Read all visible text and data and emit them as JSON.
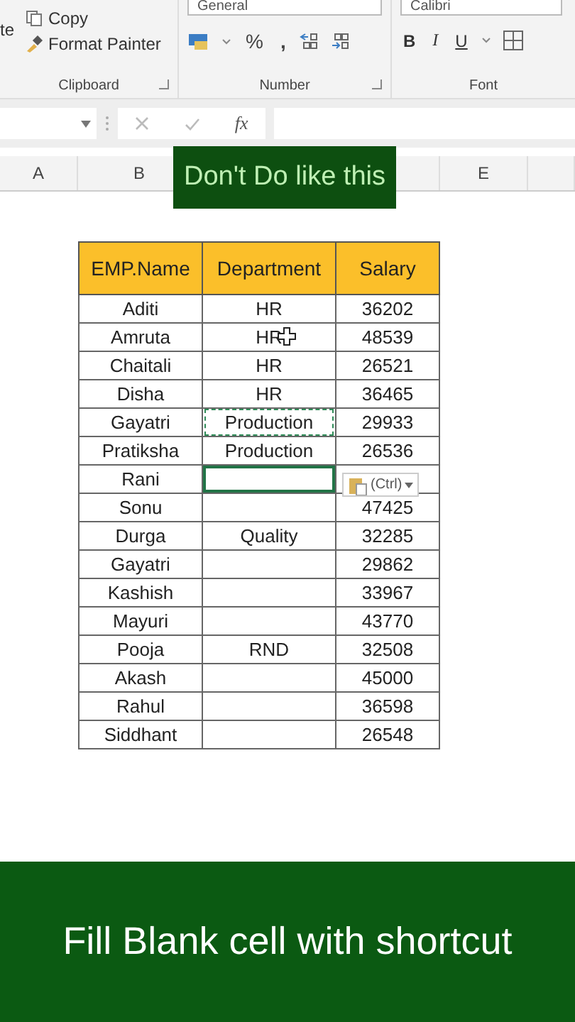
{
  "ribbon": {
    "clipboard": {
      "paste_label": "te",
      "copy": "Copy",
      "format_painter": "Format Painter",
      "group_label": "Clipboard"
    },
    "number": {
      "format": "General",
      "percent": "%",
      "comma": ",",
      "group_label": "Number"
    },
    "font": {
      "font_name": "Calibri",
      "bold": "B",
      "italic": "I",
      "underline": "U",
      "group_label": "Font"
    }
  },
  "formula_bar": {
    "fx": "fx"
  },
  "columns": [
    "A",
    "B",
    "E"
  ],
  "caption": "Don't Do like this",
  "table": {
    "columns": [
      "EMP.Name",
      "Department",
      "Salary"
    ],
    "rows": [
      {
        "name": "Aditi",
        "department": "HR",
        "salary": "36202",
        "copied": false,
        "selected": false
      },
      {
        "name": "Amruta",
        "department": "HR",
        "salary": "48539",
        "copied": false,
        "selected": false
      },
      {
        "name": "Chaitali",
        "department": "HR",
        "salary": "26521",
        "copied": false,
        "selected": false
      },
      {
        "name": "Disha",
        "department": "HR",
        "salary": "36465",
        "copied": false,
        "selected": false
      },
      {
        "name": "Gayatri",
        "department": "Production",
        "salary": "29933",
        "copied": true,
        "selected": false
      },
      {
        "name": "Pratiksha",
        "department": "Production",
        "salary": "26536",
        "copied": false,
        "selected": false
      },
      {
        "name": "Rani",
        "department": "",
        "salary": "",
        "copied": false,
        "selected": true
      },
      {
        "name": "Sonu",
        "department": "",
        "salary": "47425",
        "copied": false,
        "selected": false
      },
      {
        "name": "Durga",
        "department": "Quality",
        "salary": "32285",
        "copied": false,
        "selected": false
      },
      {
        "name": "Gayatri",
        "department": "",
        "salary": "29862",
        "copied": false,
        "selected": false
      },
      {
        "name": "Kashish",
        "department": "",
        "salary": "33967",
        "copied": false,
        "selected": false
      },
      {
        "name": "Mayuri",
        "department": "",
        "salary": "43770",
        "copied": false,
        "selected": false
      },
      {
        "name": "Pooja",
        "department": "RND",
        "salary": "32508",
        "copied": false,
        "selected": false
      },
      {
        "name": "Akash",
        "department": "",
        "salary": "45000",
        "copied": false,
        "selected": false
      },
      {
        "name": "Rahul",
        "department": "",
        "salary": "36598",
        "copied": false,
        "selected": false
      },
      {
        "name": "Siddhant",
        "department": "",
        "salary": "26548",
        "copied": false,
        "selected": false
      }
    ]
  },
  "paste_options": {
    "label": "(Ctrl)"
  },
  "banner": "Fill Blank cell with shortcut"
}
